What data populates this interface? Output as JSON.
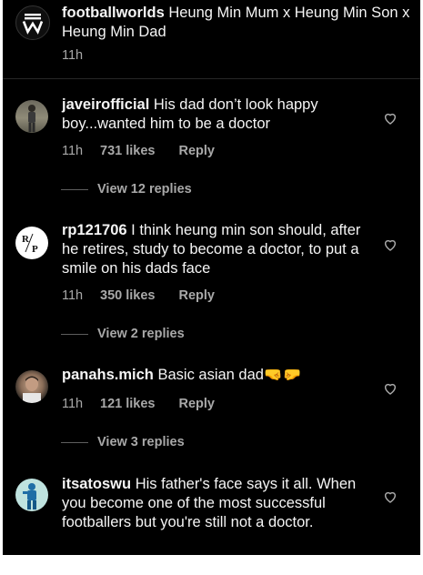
{
  "caption": {
    "username": "footballworlds",
    "text": "Heung Min Mum x Heung Min Son x Heung Min Dad",
    "time": "11h"
  },
  "comments": [
    {
      "username": "javeirofficial",
      "text": "His dad don’t look happy boy...wanted him to be a doctor",
      "time": "11h",
      "likes": "731 likes",
      "reply": "Reply",
      "view_replies": "View 12 replies"
    },
    {
      "username": "rp121706",
      "text": "I think heung min son should, after he retires, study to become a doctor, to put a smile on his dads face",
      "time": "11h",
      "likes": "350 likes",
      "reply": "Reply",
      "view_replies": "View 2 replies"
    },
    {
      "username": "panahs.mich",
      "text": "Basic asian dad",
      "emoji": "🤜🤛",
      "time": "11h",
      "likes": "121 likes",
      "reply": "Reply",
      "view_replies": "View 3 replies"
    },
    {
      "username": "itsatoswu",
      "text": "His father's face says it all. When you become one of the most successful footballers but you're still not a doctor."
    }
  ],
  "avatar_logo_text": "R P",
  "icons": {
    "logo": "footballworlds-logo-icon",
    "like": "heart-outline-icon"
  },
  "colors": {
    "background": "#000000",
    "text": "#f5f5f5",
    "secondary": "#a8a8a8",
    "divider": "#262626"
  }
}
